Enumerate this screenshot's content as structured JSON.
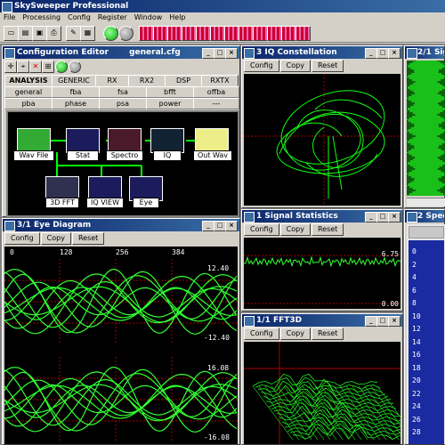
{
  "app": {
    "title": "SkySweeper Professional",
    "menu": [
      "File",
      "Processing",
      "Config",
      "Register",
      "Window",
      "Help"
    ]
  },
  "config_editor": {
    "title": "Configuration Editor",
    "file": "general.cfg",
    "tabs": [
      "ANALYSIS",
      "GENERIC",
      "RX",
      "RX2",
      "DSP",
      "RXTX"
    ],
    "row1": [
      "general",
      "fba",
      "fsa",
      "bfft",
      "offba"
    ],
    "row2": [
      "pba",
      "phase",
      "psa",
      "power",
      "---"
    ],
    "nodes": [
      "Wav File",
      "Stat",
      "Spectro",
      "IQ",
      "Out Wav",
      "3D FFT",
      "IQ VIEW",
      "Eye"
    ]
  },
  "iq": {
    "title": "3 IQ Constellation"
  },
  "win21": {
    "title": "2/1 Sig"
  },
  "eye": {
    "title": "3/1 Eye Diagram",
    "xticks": [
      "0",
      "128",
      "256",
      "384"
    ],
    "top_max": "12.40",
    "top_min": "-12.40",
    "bot_max": "16.08",
    "bot_min": "-16.08"
  },
  "stats": {
    "title": "1 Signal Statistics",
    "max": "6.75",
    "min": "0.00"
  },
  "fft3d": {
    "title": "1/1 FFT3D"
  },
  "spectro": {
    "title": "2 Spectr",
    "ticks": [
      "0",
      "2",
      "4",
      "6",
      "8",
      "10",
      "12",
      "14",
      "16",
      "18",
      "20",
      "22",
      "24",
      "26",
      "28"
    ]
  },
  "buttons": {
    "config": "Config",
    "copy": "Copy",
    "reset": "Reset"
  }
}
